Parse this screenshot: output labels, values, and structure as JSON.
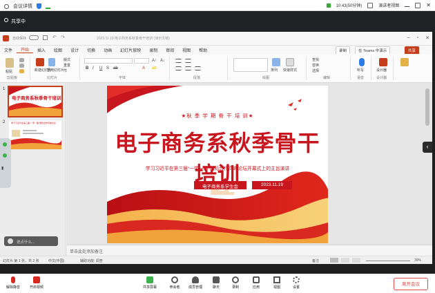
{
  "meeting": {
    "title": "会议详情",
    "time": "10:43(50分钟)",
    "view_label": "演讲者视图",
    "share_label": "共享中"
  },
  "ppt": {
    "autosave": "自动保存",
    "doc_title": "2023.11.19 电子商务系秋季骨干培训 (演示文稿)",
    "tabs": [
      "文件",
      "开始",
      "插入",
      "绘图",
      "设计",
      "切换",
      "动画",
      "幻灯片放映",
      "录制",
      "审阅",
      "视图",
      "帮助"
    ],
    "active_tab": "开始",
    "record_btn": "录制",
    "teams_btn": "在 Teams 中演示",
    "share_btn": "共享",
    "ribbon_groups": [
      "剪贴板",
      "幻灯片",
      "字体",
      "段落",
      "绘图",
      "编辑",
      "语音",
      "设计器"
    ],
    "paste": "粘贴",
    "new_slide": "新建幻灯片",
    "reuse": "重用幻灯片",
    "layout": "版式",
    "reset": "重置",
    "section": "节",
    "find": "查找",
    "replace": "替换",
    "select": "选择",
    "dictate": "听写",
    "designer": "设计器",
    "arrange": "排列",
    "quick_styles": "快速样式",
    "notes_placeholder": "单击此处添加备注",
    "status": {
      "slide_of": "幻灯片 第 1 张，共 2 张",
      "lang": "中文(中国)",
      "accessibility": "辅助功能: 调查",
      "notes": "备注",
      "zoom": "39%"
    }
  },
  "slide": {
    "subtitle": "★秋 季 学 期 骨 干 培 训★",
    "title": "电子商务系秋季骨干培训",
    "tagline": "学习习近平在第三届“一带一路”国际合作高峰论坛开幕式上的主旨演讲",
    "organizer": "电子商务系学生会",
    "date": "2023.11.19"
  },
  "thumbnails": [
    {
      "num": "1",
      "title": "电子商务系秋季骨干培训"
    },
    {
      "num": "2",
      "title": "学习习近平在第三届“一带一路”国际合作高峰论坛"
    }
  ],
  "chat_placeholder": "说点什么...",
  "toolbar": {
    "mic": "解除静音",
    "camera": "开启视频",
    "share": "共享屏幕",
    "participants": "参会者",
    "members": "成员管理",
    "chat": "聊天",
    "record": "录制",
    "apps": "应用",
    "view": "视图",
    "settings": "设置",
    "leave": "离开会议"
  },
  "colors": {
    "accent_red": "#c7161e",
    "ppt_accent": "#c43e1c",
    "leave_red": "#e04a4a"
  }
}
